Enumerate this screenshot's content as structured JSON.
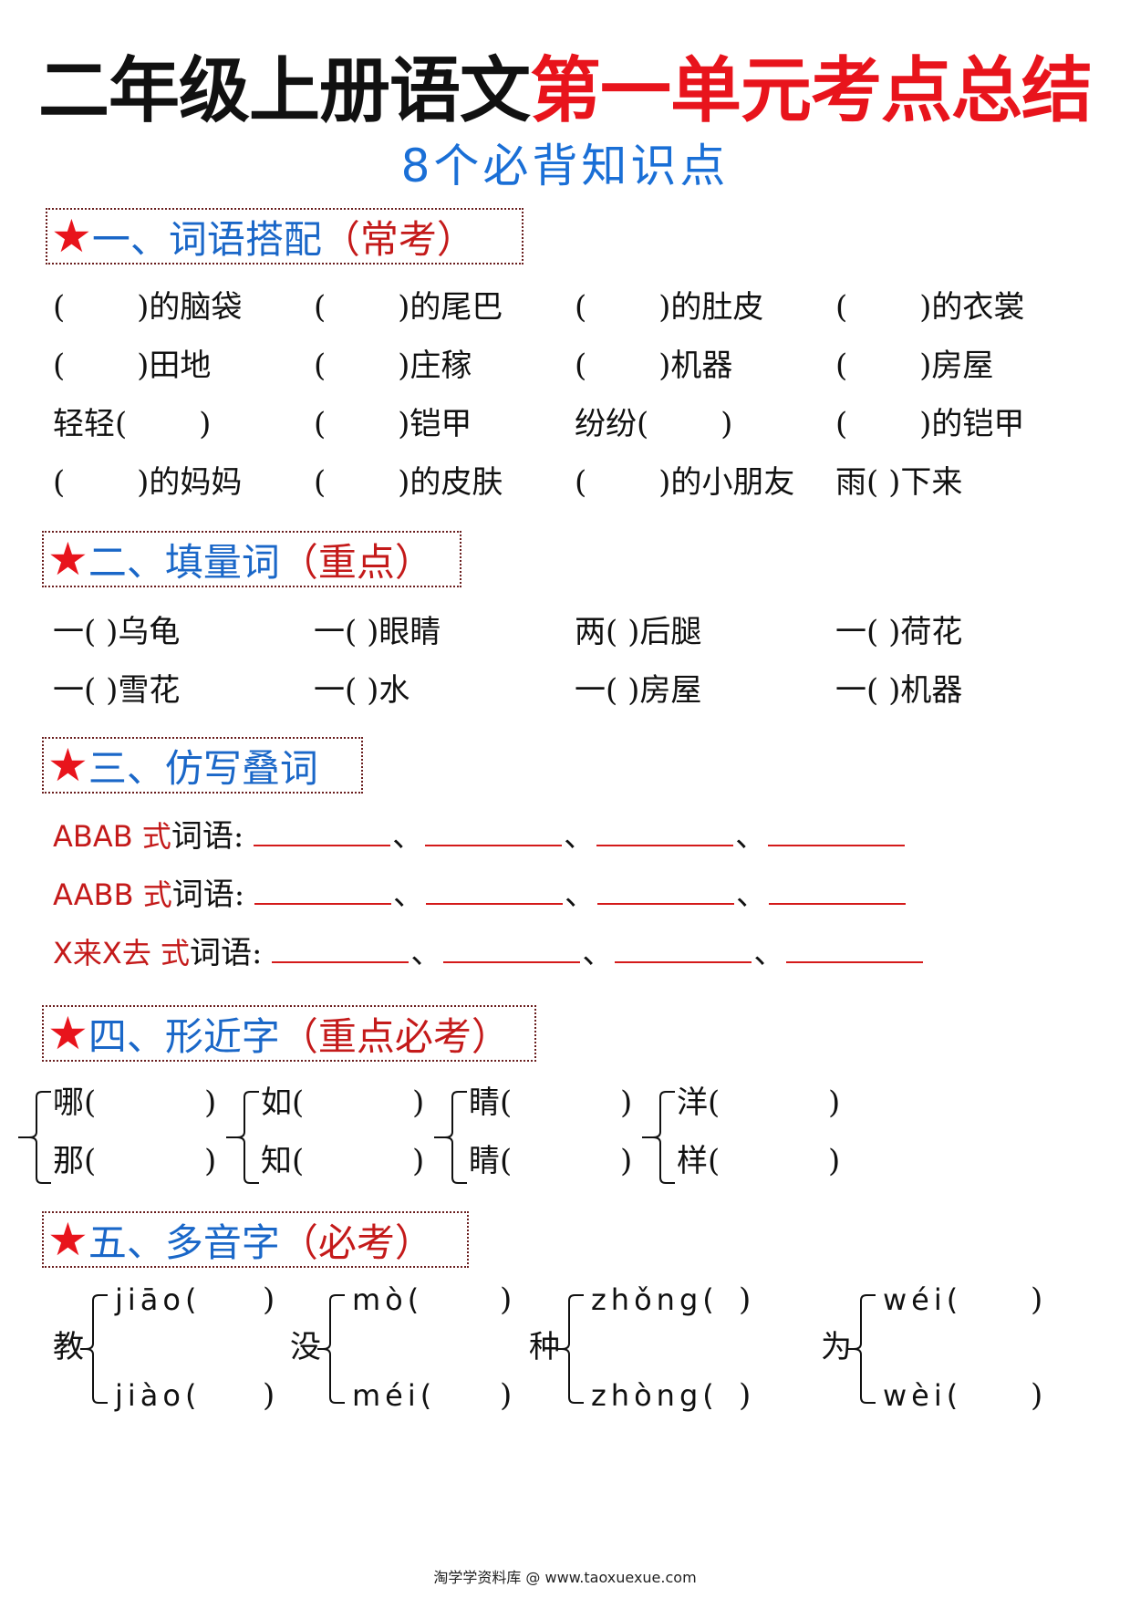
{
  "title": {
    "black": "二年级上册语文",
    "red": "第一单元考点总结"
  },
  "subtitle": "8个必背知识点",
  "colors": {
    "title_red": "#e8141c",
    "heading_blue": "#1a67c8",
    "heading_red": "#c41a1a",
    "star": "#e8141c",
    "blank_line": "#d41a1a",
    "subtitle_blue": "#1a6fd6"
  },
  "sections": [
    {
      "icon": "star-icon",
      "star": "★",
      "num": "一、",
      "name": "词语搭配",
      "tag": "（常考）",
      "rows": [
        [
          "(   )的脑袋",
          "(   )的尾巴",
          "(   )的肚皮",
          "(   )的衣裳"
        ],
        [
          "(   )田地",
          "(   )庄稼",
          "(   )机器",
          "(   )房屋"
        ],
        [
          "轻轻(   )",
          "(   )铠甲",
          "纷纷(   )",
          "(   )的铠甲"
        ],
        [
          "(   )的妈妈",
          "(   )的皮肤",
          "(   )的小朋友",
          "雨( )下来"
        ]
      ]
    },
    {
      "icon": "star-icon",
      "star": "★",
      "num": "二、",
      "name": "填量词",
      "tag": "（重点）",
      "rows": [
        [
          "一( )乌龟",
          "一( )眼睛",
          "两( )后腿",
          "一( )荷花"
        ],
        [
          "一( )雪花",
          "一( )水",
          "一( )房屋",
          "一( )机器"
        ]
      ]
    },
    {
      "icon": "star-icon",
      "star": "★",
      "num": "三、",
      "name": "仿写叠词",
      "tag": "",
      "rows": [
        {
          "label_red": "ABAB 式",
          "label_black": "词语:",
          "blanks": 4,
          "sep": "、"
        },
        {
          "label_red": "AABB 式",
          "label_black": "词语:",
          "blanks": 4,
          "sep": "、"
        },
        {
          "label_red": "X来X去 式",
          "label_black": "词语:",
          "blanks": 4,
          "sep": "、"
        }
      ]
    },
    {
      "icon": "star-icon",
      "star": "★",
      "num": "四、",
      "name": "形近字",
      "tag": "（重点必考）",
      "groups": [
        {
          "top": "哪(",
          "bottom": "那(",
          "close": ")"
        },
        {
          "top": "如(",
          "bottom": "知(",
          "close": ")"
        },
        {
          "top": "睛(",
          "bottom": "睛(",
          "close": ")"
        },
        {
          "top": "洋(",
          "bottom": "样(",
          "close": ")"
        }
      ]
    },
    {
      "icon": "star-icon",
      "star": "★",
      "num": "五、",
      "name": "多音字",
      "tag": "（必考）",
      "groups": [
        {
          "char": "教",
          "top": "jiāo(",
          "bottom": "jiào(",
          "close": ")"
        },
        {
          "char": "没",
          "top": "mò(",
          "bottom": "méi(",
          "close": ")"
        },
        {
          "char": "种",
          "top": "zhǒng(",
          "bottom": "zhòng(",
          "close": ")"
        },
        {
          "char": "为",
          "top": "wéi(",
          "bottom": "wèi(",
          "close": ")"
        }
      ]
    }
  ],
  "footer": "淘学学资料库 @ www.taoxuexue.com"
}
